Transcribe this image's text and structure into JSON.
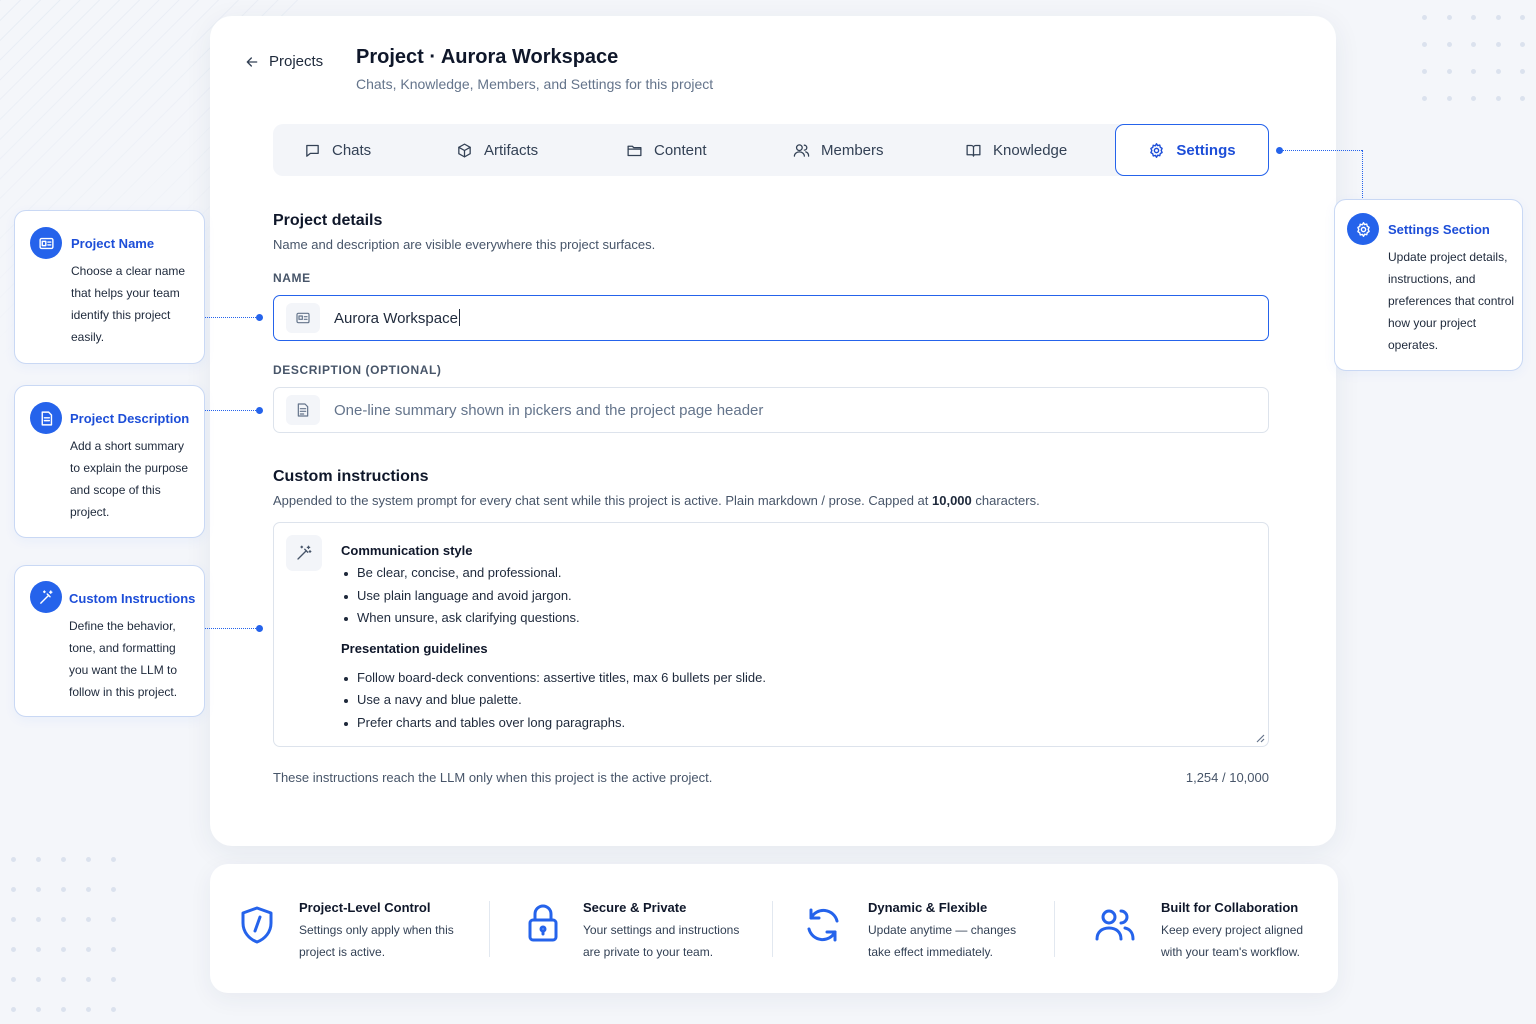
{
  "header": {
    "back_label": "Projects",
    "title": "Project · Aurora Workspace",
    "subtitle": "Chats, Knowledge, Members, and Settings for this project"
  },
  "tabs": [
    {
      "label": "Chats",
      "icon": "chat-icon"
    },
    {
      "label": "Artifacts",
      "icon": "cube-icon"
    },
    {
      "label": "Content",
      "icon": "folder-icon"
    },
    {
      "label": "Members",
      "icon": "users-icon"
    },
    {
      "label": "Knowledge",
      "icon": "book-icon"
    },
    {
      "label": "Settings",
      "icon": "gear-icon",
      "active": true
    }
  ],
  "project_details": {
    "title": "Project details",
    "description": "Name and description are visible everywhere this project surfaces.",
    "name_label": "NAME",
    "name_value": "Aurora Workspace",
    "description_label": "DESCRIPTION (OPTIONAL)",
    "description_placeholder": "One-line summary shown in pickers and the project page header"
  },
  "custom_instructions": {
    "title": "Custom instructions",
    "desc_prefix": "Appended to the system prompt for every chat sent while this project is active. Plain markdown / prose. Capped at ",
    "desc_cap": "10,000",
    "desc_suffix": " characters.",
    "heading1": "Communication style",
    "bullets1": [
      "Be clear, concise, and professional.",
      "Use plain language and avoid jargon.",
      "When unsure, ask clarifying questions."
    ],
    "heading2": "Presentation guidelines",
    "bullets2": [
      "Follow board-deck conventions: assertive titles, max 6 bullets per slide.",
      "Use a navy and blue palette.",
      "Prefer charts and tables over long paragraphs."
    ],
    "footnote": "These instructions reach the LLM only when this project is the active project.",
    "counter": "1,254 / 10,000"
  },
  "callouts": {
    "name": {
      "title": "Project Name",
      "body": "Choose a clear name that helps your team identify this project easily."
    },
    "description": {
      "title": "Project Description",
      "body": "Add a short summary to explain the purpose and scope of this project."
    },
    "instructions": {
      "title": "Custom Instructions",
      "body": "Define the behavior, tone, and formatting you want the LLM to follow in this project."
    },
    "settings": {
      "title": "Settings Section",
      "body": "Update project details, instructions, and preferences that control how your project operates."
    }
  },
  "features": [
    {
      "title": "Project-Level Control",
      "desc": "Settings only apply when this project is active.",
      "icon": "shield-icon"
    },
    {
      "title": "Secure & Private",
      "desc": "Your settings and instructions are private to your team.",
      "icon": "lock-icon"
    },
    {
      "title": "Dynamic & Flexible",
      "desc": "Update anytime — changes take effect immediately.",
      "icon": "refresh-icon"
    },
    {
      "title": "Built for Collaboration",
      "desc": "Keep every project aligned with your team's workflow.",
      "icon": "team-icon"
    }
  ],
  "colors": {
    "accent": "#2563eb",
    "accent_dark": "#1d4ed8",
    "background": "#f4f6fa",
    "card": "#ffffff",
    "border": "#dde3ec"
  }
}
